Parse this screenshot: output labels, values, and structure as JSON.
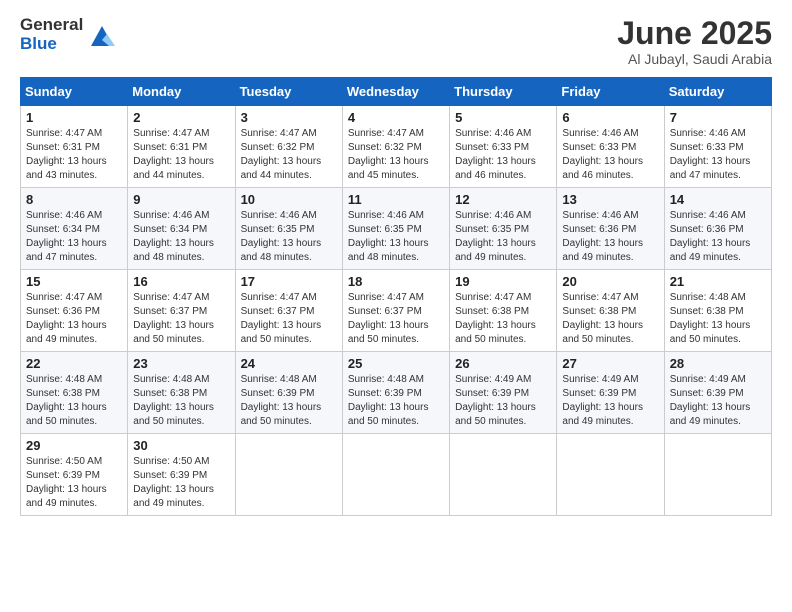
{
  "logo": {
    "general": "General",
    "blue": "Blue"
  },
  "title": "June 2025",
  "subtitle": "Al Jubayl, Saudi Arabia",
  "weekdays": [
    "Sunday",
    "Monday",
    "Tuesday",
    "Wednesday",
    "Thursday",
    "Friday",
    "Saturday"
  ],
  "weeks": [
    [
      {
        "day": "1",
        "sunrise": "4:47 AM",
        "sunset": "6:31 PM",
        "daylight": "13 hours and 43 minutes."
      },
      {
        "day": "2",
        "sunrise": "4:47 AM",
        "sunset": "6:31 PM",
        "daylight": "13 hours and 44 minutes."
      },
      {
        "day": "3",
        "sunrise": "4:47 AM",
        "sunset": "6:32 PM",
        "daylight": "13 hours and 44 minutes."
      },
      {
        "day": "4",
        "sunrise": "4:47 AM",
        "sunset": "6:32 PM",
        "daylight": "13 hours and 45 minutes."
      },
      {
        "day": "5",
        "sunrise": "4:46 AM",
        "sunset": "6:33 PM",
        "daylight": "13 hours and 46 minutes."
      },
      {
        "day": "6",
        "sunrise": "4:46 AM",
        "sunset": "6:33 PM",
        "daylight": "13 hours and 46 minutes."
      },
      {
        "day": "7",
        "sunrise": "4:46 AM",
        "sunset": "6:33 PM",
        "daylight": "13 hours and 47 minutes."
      }
    ],
    [
      {
        "day": "8",
        "sunrise": "4:46 AM",
        "sunset": "6:34 PM",
        "daylight": "13 hours and 47 minutes."
      },
      {
        "day": "9",
        "sunrise": "4:46 AM",
        "sunset": "6:34 PM",
        "daylight": "13 hours and 48 minutes."
      },
      {
        "day": "10",
        "sunrise": "4:46 AM",
        "sunset": "6:35 PM",
        "daylight": "13 hours and 48 minutes."
      },
      {
        "day": "11",
        "sunrise": "4:46 AM",
        "sunset": "6:35 PM",
        "daylight": "13 hours and 48 minutes."
      },
      {
        "day": "12",
        "sunrise": "4:46 AM",
        "sunset": "6:35 PM",
        "daylight": "13 hours and 49 minutes."
      },
      {
        "day": "13",
        "sunrise": "4:46 AM",
        "sunset": "6:36 PM",
        "daylight": "13 hours and 49 minutes."
      },
      {
        "day": "14",
        "sunrise": "4:46 AM",
        "sunset": "6:36 PM",
        "daylight": "13 hours and 49 minutes."
      }
    ],
    [
      {
        "day": "15",
        "sunrise": "4:47 AM",
        "sunset": "6:36 PM",
        "daylight": "13 hours and 49 minutes."
      },
      {
        "day": "16",
        "sunrise": "4:47 AM",
        "sunset": "6:37 PM",
        "daylight": "13 hours and 50 minutes."
      },
      {
        "day": "17",
        "sunrise": "4:47 AM",
        "sunset": "6:37 PM",
        "daylight": "13 hours and 50 minutes."
      },
      {
        "day": "18",
        "sunrise": "4:47 AM",
        "sunset": "6:37 PM",
        "daylight": "13 hours and 50 minutes."
      },
      {
        "day": "19",
        "sunrise": "4:47 AM",
        "sunset": "6:38 PM",
        "daylight": "13 hours and 50 minutes."
      },
      {
        "day": "20",
        "sunrise": "4:47 AM",
        "sunset": "6:38 PM",
        "daylight": "13 hours and 50 minutes."
      },
      {
        "day": "21",
        "sunrise": "4:48 AM",
        "sunset": "6:38 PM",
        "daylight": "13 hours and 50 minutes."
      }
    ],
    [
      {
        "day": "22",
        "sunrise": "4:48 AM",
        "sunset": "6:38 PM",
        "daylight": "13 hours and 50 minutes."
      },
      {
        "day": "23",
        "sunrise": "4:48 AM",
        "sunset": "6:38 PM",
        "daylight": "13 hours and 50 minutes."
      },
      {
        "day": "24",
        "sunrise": "4:48 AM",
        "sunset": "6:39 PM",
        "daylight": "13 hours and 50 minutes."
      },
      {
        "day": "25",
        "sunrise": "4:48 AM",
        "sunset": "6:39 PM",
        "daylight": "13 hours and 50 minutes."
      },
      {
        "day": "26",
        "sunrise": "4:49 AM",
        "sunset": "6:39 PM",
        "daylight": "13 hours and 50 minutes."
      },
      {
        "day": "27",
        "sunrise": "4:49 AM",
        "sunset": "6:39 PM",
        "daylight": "13 hours and 49 minutes."
      },
      {
        "day": "28",
        "sunrise": "4:49 AM",
        "sunset": "6:39 PM",
        "daylight": "13 hours and 49 minutes."
      }
    ],
    [
      {
        "day": "29",
        "sunrise": "4:50 AM",
        "sunset": "6:39 PM",
        "daylight": "13 hours and 49 minutes."
      },
      {
        "day": "30",
        "sunrise": "4:50 AM",
        "sunset": "6:39 PM",
        "daylight": "13 hours and 49 minutes."
      },
      null,
      null,
      null,
      null,
      null
    ]
  ],
  "labels": {
    "sunrise": "Sunrise:",
    "sunset": "Sunset:",
    "daylight": "Daylight:"
  }
}
